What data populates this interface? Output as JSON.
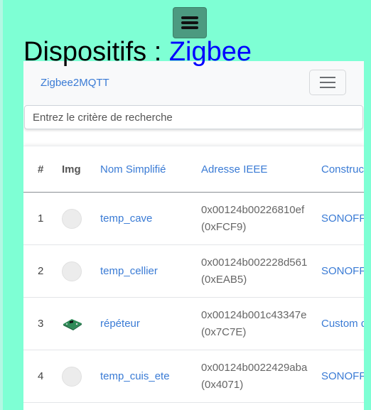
{
  "header": {
    "menu_icon": "hamburger-menu-icon",
    "title_prefix": "Dispositifs : ",
    "title_accent": "Zigbee",
    "accent_color": "#0000ff",
    "background_color": "#7effd4"
  },
  "navbar": {
    "brand": "Zigbee2MQTT",
    "toggler_icon": "hamburger-menu-icon"
  },
  "search": {
    "placeholder": "Entrez le critère de recherche",
    "value": ""
  },
  "table": {
    "columns": [
      "#",
      "Img",
      "Nom Simplifié",
      "Adresse IEEE",
      "Constructeur"
    ],
    "rows": [
      {
        "index": "1",
        "image": "placeholder-circle",
        "name": "temp_cave",
        "ieee": "0x00124b00226810ef",
        "nwk": "(0xFCF9)",
        "manufacturer": "SONOFF"
      },
      {
        "index": "2",
        "image": "placeholder-circle",
        "name": "temp_cellier",
        "ieee": "0x00124b002228d561",
        "nwk": "(0xEAB5)",
        "manufacturer": "SONOFF"
      },
      {
        "index": "3",
        "image": "green-circuit-board",
        "name": "répéteur",
        "ieee": "0x00124b001c43347e",
        "nwk": "(0x7C7E)",
        "manufacturer": "Custom devices (DiY)"
      },
      {
        "index": "4",
        "image": "placeholder-circle",
        "name": "temp_cuis_ete",
        "ieee": "0x00124b0022429aba",
        "nwk": "(0x4071)",
        "manufacturer": "SONOFF"
      }
    ]
  }
}
